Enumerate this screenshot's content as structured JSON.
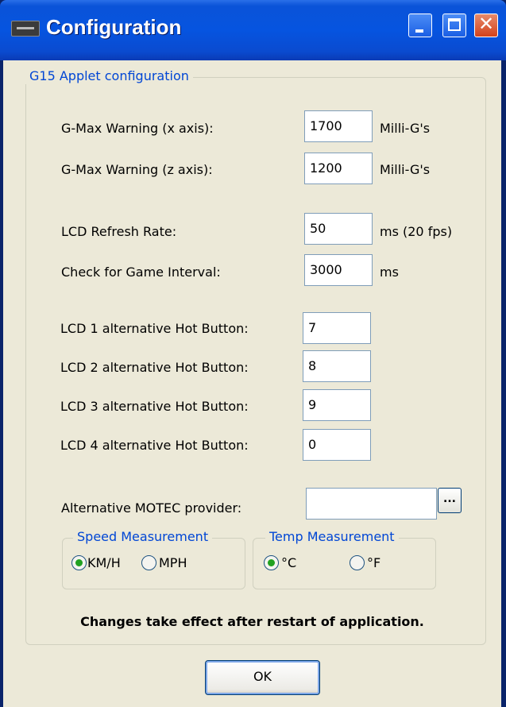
{
  "window": {
    "title": "Configuration",
    "controls": {
      "minimize": "minimize",
      "maximize": "maximize",
      "close": "✕"
    }
  },
  "group": {
    "title": "G15 Applet configuration",
    "fields": [
      {
        "label": "G-Max Warning (x axis):",
        "value": "1700",
        "unit": "Milli-G's"
      },
      {
        "label": "G-Max Warning (z axis):",
        "value": "1200",
        "unit": "Milli-G's"
      },
      {
        "label": "LCD Refresh Rate:",
        "value": "50",
        "unit": "ms (20 fps)"
      },
      {
        "label": "Check for Game Interval:",
        "value": "3000",
        "unit": "ms"
      },
      {
        "label": "LCD 1 alternative Hot Button:",
        "value": "7"
      },
      {
        "label": "LCD 2 alternative Hot Button:",
        "value": "8"
      },
      {
        "label": "LCD 3 alternative Hot Button:",
        "value": "9"
      },
      {
        "label": "LCD 4 alternative Hot Button:",
        "value": "0"
      }
    ],
    "motec": {
      "label": "Alternative MOTEC provider:",
      "value": "",
      "browse_label": "..."
    },
    "speed": {
      "title": "Speed Measurement",
      "options": [
        {
          "label": "KM/H",
          "checked": true
        },
        {
          "label": "MPH",
          "checked": false
        }
      ]
    },
    "temp": {
      "title": "Temp Measurement",
      "options": [
        {
          "label": "°C",
          "checked": true
        },
        {
          "label": "°F",
          "checked": false
        }
      ]
    }
  },
  "footer": {
    "note": "Changes take effect after restart of application.",
    "ok_label": "OK"
  }
}
